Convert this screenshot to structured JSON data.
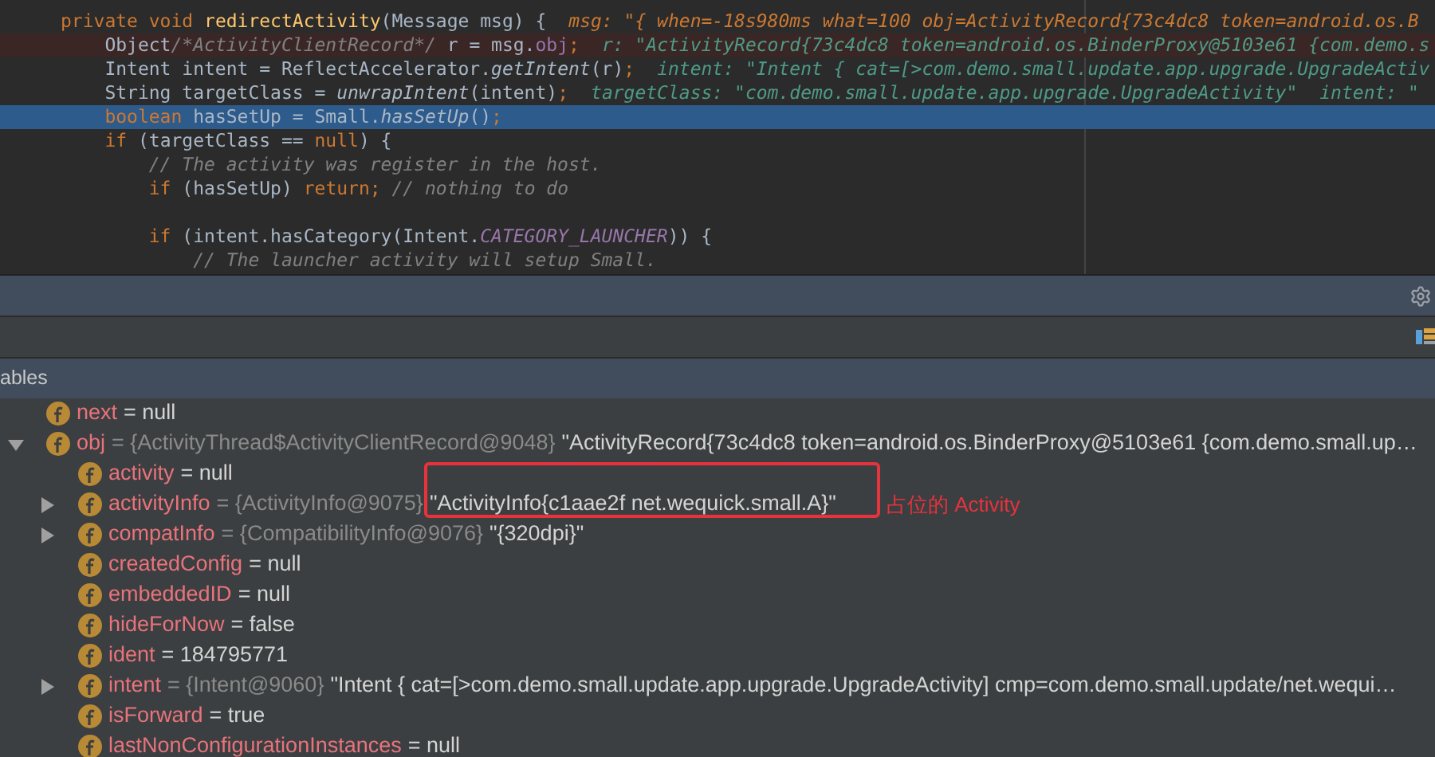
{
  "editor": {
    "lines": [
      {
        "current": false,
        "highlighted": false,
        "tokens": [
          {
            "kind": "keyword",
            "text": "private void "
          },
          {
            "kind": "declaration",
            "text": "redirectActivity"
          },
          {
            "kind": "plain",
            "text": "(Message msg) {"
          }
        ],
        "hints": [
          {
            "kind": "changed",
            "text": "msg: \"{ when=-18s980ms what=100 obj=ActivityRecord{73c4dc8 token=android.os.B"
          }
        ]
      },
      {
        "current": false,
        "highlighted": true,
        "tokens": [
          {
            "kind": "plain",
            "text": "    Object"
          },
          {
            "kind": "comment",
            "text": "/*ActivityClientRecord*/"
          },
          {
            "kind": "plain",
            "text": " r = msg."
          },
          {
            "kind": "field",
            "text": "obj"
          },
          {
            "kind": "keyword",
            "text": ";"
          }
        ],
        "hints": [
          {
            "kind": "normal",
            "text": "r: \"ActivityRecord{73c4dc8 token=android.os.BinderProxy@5103e61 {com.demo.s"
          }
        ]
      },
      {
        "current": false,
        "highlighted": false,
        "tokens": [
          {
            "kind": "plain",
            "text": "    Intent intent = ReflectAccelerator."
          },
          {
            "kind": "static",
            "text": "getIntent"
          },
          {
            "kind": "plain",
            "text": "(r)"
          },
          {
            "kind": "keyword",
            "text": ";"
          }
        ],
        "hints": [
          {
            "kind": "normal",
            "text": "intent: \"Intent { cat=[>com.demo.small.update.app.upgrade.UpgradeActiv"
          }
        ]
      },
      {
        "current": false,
        "highlighted": false,
        "tokens": [
          {
            "kind": "plain",
            "text": "    String targetClass = "
          },
          {
            "kind": "static",
            "text": "unwrapIntent"
          },
          {
            "kind": "plain",
            "text": "(intent)"
          },
          {
            "kind": "keyword",
            "text": ";"
          }
        ],
        "hints": [
          {
            "kind": "normal",
            "text": "targetClass: \"com.demo.small.update.app.upgrade.UpgradeActivity\""
          },
          {
            "kind": "normal",
            "text": "intent: \""
          }
        ]
      },
      {
        "current": true,
        "highlighted": false,
        "tokens": [
          {
            "kind": "keyword",
            "text": "    boolean "
          },
          {
            "kind": "plain",
            "text": "hasSetUp = Small."
          },
          {
            "kind": "static",
            "text": "hasSetUp"
          },
          {
            "kind": "plain",
            "text": "()"
          },
          {
            "kind": "keyword",
            "text": ";"
          }
        ]
      },
      {
        "current": false,
        "highlighted": false,
        "tokens": [
          {
            "kind": "keyword",
            "text": "    if "
          },
          {
            "kind": "plain",
            "text": "(targetClass == "
          },
          {
            "kind": "keyword",
            "text": "null"
          },
          {
            "kind": "plain",
            "text": ") {"
          }
        ]
      },
      {
        "current": false,
        "highlighted": false,
        "tokens": [
          {
            "kind": "comment",
            "text": "        // The activity was register in the host."
          }
        ]
      },
      {
        "current": false,
        "highlighted": false,
        "tokens": [
          {
            "kind": "keyword",
            "text": "        if "
          },
          {
            "kind": "plain",
            "text": "(hasSetUp) "
          },
          {
            "kind": "keyword",
            "text": "return;"
          },
          {
            "kind": "comment",
            "text": " // nothing to do"
          }
        ]
      },
      {
        "current": false,
        "highlighted": false
      },
      {
        "current": false,
        "highlighted": false,
        "tokens": [
          {
            "kind": "keyword",
            "text": "        if "
          },
          {
            "kind": "plain",
            "text": "(intent.hasCategory(Intent."
          },
          {
            "kind": "constant",
            "text": "CATEGORY_LAUNCHER"
          },
          {
            "kind": "plain",
            "text": ")) {"
          }
        ]
      },
      {
        "current": false,
        "highlighted": false,
        "tokens": [
          {
            "kind": "comment",
            "text": "            // The launcher activity will setup Small."
          }
        ]
      }
    ]
  },
  "variables": {
    "title": "ables",
    "rows": [
      {
        "name": "next",
        "value": "= null"
      },
      {
        "name": "obj",
        "expanded": true,
        "ref": "= {ActivityThread$ActivityClientRecord@9048}",
        "value": "\"ActivityRecord{73c4dc8 token=android.os.BinderProxy@5103e61 {com.demo.small.up…",
        "children": [
          {
            "name": "activity",
            "value": "= null"
          },
          {
            "name": "activityInfo",
            "expanded": false,
            "ref": "= {ActivityInfo@9075}",
            "value": "\"ActivityInfo{c1aae2f net.wequick.small.A}\""
          },
          {
            "name": "compatInfo",
            "expanded": false,
            "ref": "= {CompatibilityInfo@9076}",
            "value": "\"{320dpi}\""
          },
          {
            "name": "createdConfig",
            "value": "= null"
          },
          {
            "name": "embeddedID",
            "value": "= null"
          },
          {
            "name": "hideForNow",
            "value": "= false"
          },
          {
            "name": "ident",
            "value": "= 184795771"
          },
          {
            "name": "intent",
            "expanded": false,
            "ref": "= {Intent@9060}",
            "value": "\"Intent { cat=[>com.demo.small.update.app.upgrade.UpgradeActivity] cmp=com.demo.small.update/net.wequi…"
          },
          {
            "name": "isForward",
            "value": "= true"
          },
          {
            "name": "lastNonConfigurationInstances",
            "value": "= null"
          }
        ]
      }
    ]
  },
  "annotation": {
    "text": "占位的 Activity"
  }
}
